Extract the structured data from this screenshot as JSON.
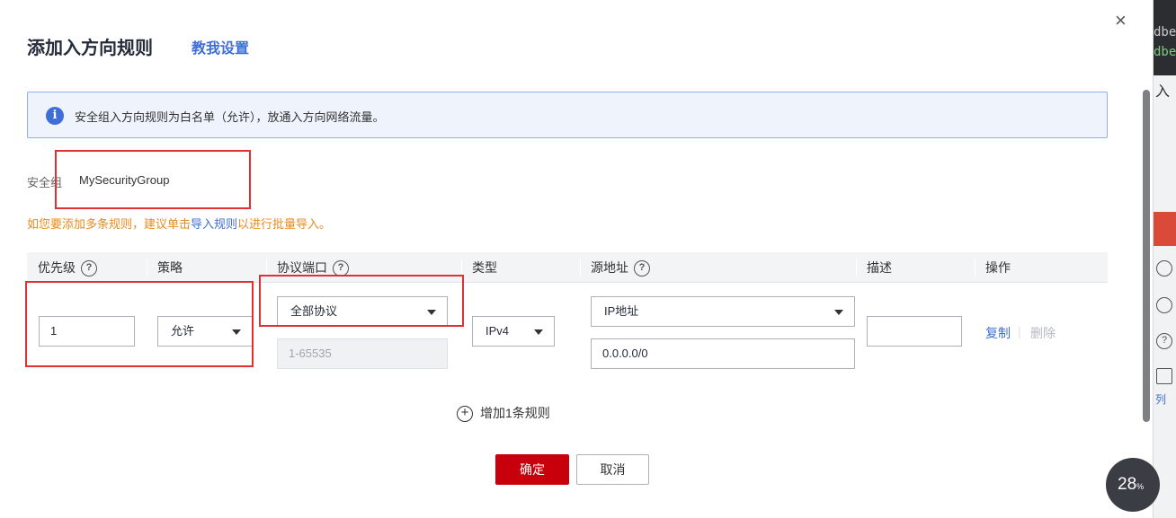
{
  "dialog": {
    "title": "添加入方向规则",
    "help_link": "教我设置",
    "close_glyph": "×"
  },
  "info": {
    "icon": "info-icon",
    "icon_glyph": "i",
    "text": "安全组入方向规则为白名单（允许），放通入方向网络流量。"
  },
  "security_group": {
    "label": "安全组",
    "value": "MySecurityGroup"
  },
  "tip": {
    "before": "如您要添加多条规则，建议单击",
    "link": "导入规则",
    "after": "以进行批量导入。"
  },
  "table": {
    "headers": {
      "priority": "优先级",
      "policy": "策略",
      "protocol_port": "协议端口",
      "type": "类型",
      "source": "源地址",
      "description": "描述",
      "operation": "操作"
    },
    "help_glyph": "?",
    "row": {
      "priority": "1",
      "policy": "允许",
      "protocol": "全部协议",
      "port_placeholder": "1-65535",
      "type": "IPv4",
      "source_type": "IP地址",
      "source_address": "0.0.0.0/0",
      "description": "",
      "copy": "复制",
      "separator": "|",
      "delete": "删除"
    }
  },
  "add_rule": {
    "glyph": "+",
    "label": "增加1条规则"
  },
  "buttons": {
    "ok": "确定",
    "cancel": "取消"
  },
  "background": {
    "dark_lines": [
      "dbe",
      "dbe"
    ],
    "text": "入",
    "link_fragment": "列"
  },
  "progress": {
    "value": "28",
    "unit": "%"
  },
  "colors": {
    "primary_red": "#c7000b",
    "link_blue": "#3f6fd6",
    "tip_orange": "#e88b1c",
    "annotation_red": "#e03030"
  }
}
